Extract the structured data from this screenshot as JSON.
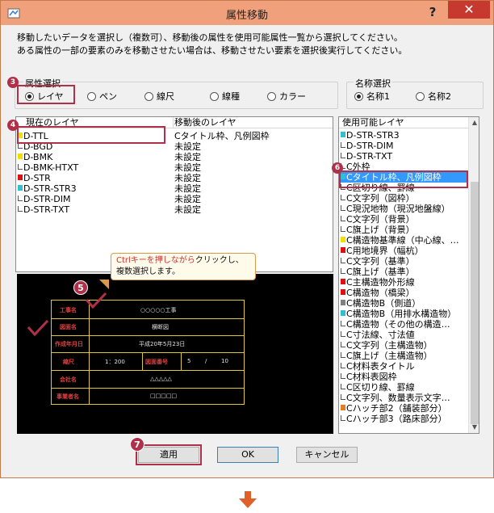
{
  "window": {
    "title": "属性移動",
    "help_label": "?",
    "close_label": "✕"
  },
  "description": [
    "移動したいデータを選択し（複数可）、移動後の属性を使用可能属性一覧から選択してください。",
    "ある属性の一部の要素のみを移動させたい場合は、移動させたい要素を選択後実行してください。"
  ],
  "attribute_group": {
    "legend": "属性選択",
    "options": [
      "レイヤ",
      "ペン",
      "線尺",
      "線種",
      "カラー"
    ],
    "selected": "レイヤ"
  },
  "name_group": {
    "legend": "名称選択",
    "options": [
      "名称1",
      "名称2"
    ],
    "selected": "名称1"
  },
  "layer_list": {
    "headers": [
      "現在のレイヤ",
      "移動後のレイヤ"
    ],
    "rows": [
      {
        "name": "D-TTL",
        "swatch": "#f0e000",
        "target": "Cタイトル枠、凡例図枠"
      },
      {
        "name": "D-BGD",
        "swatch": "outline",
        "target": "未設定"
      },
      {
        "name": "D-BMK",
        "swatch": "#f0e000",
        "target": "未設定"
      },
      {
        "name": "D-BMK-HTXT",
        "swatch": "outline",
        "target": "未設定"
      },
      {
        "name": "D-STR",
        "swatch": "#e01010",
        "target": "未設定"
      },
      {
        "name": "D-STR-STR3",
        "swatch": "#30c0d0",
        "target": "未設定"
      },
      {
        "name": "D-STR-DIM",
        "swatch": "outline",
        "target": "未設定"
      },
      {
        "name": "D-STR-TXT",
        "swatch": "outline",
        "target": "未設定"
      }
    ]
  },
  "available_list": {
    "header": "使用可能レイヤ",
    "items": [
      {
        "name": "D-STR-STR3",
        "swatch": "#30c0d0"
      },
      {
        "name": "D-STR-DIM",
        "swatch": "outline"
      },
      {
        "name": "D-STR-TXT",
        "swatch": "outline"
      },
      {
        "name": "C外枠",
        "swatch": "outline"
      },
      {
        "name": "Cタイトル枠、凡例図枠",
        "swatch": "#30c0d0",
        "selected": true
      },
      {
        "name": "C区切り線、罫線",
        "swatch": "outline"
      },
      {
        "name": "C文字列（図枠）",
        "swatch": "outline"
      },
      {
        "name": "C現況地物（現況地盤線）",
        "swatch": "outline"
      },
      {
        "name": "C文字列（背景）",
        "swatch": "outline"
      },
      {
        "name": "C旗上げ（背景）",
        "swatch": "outline"
      },
      {
        "name": "C構造物基準線（中心線、…",
        "swatch": "#f0e000"
      },
      {
        "name": "C用地境界（幅杭）",
        "swatch": "#e01010"
      },
      {
        "name": "C文字列（基準）",
        "swatch": "outline"
      },
      {
        "name": "C旗上げ（基準）",
        "swatch": "outline"
      },
      {
        "name": "C主構造物外形線",
        "swatch": "#e01010"
      },
      {
        "name": "C構造物（橋梁）",
        "swatch": "#e01010"
      },
      {
        "name": "C構造物B（側道）",
        "swatch": "#808080"
      },
      {
        "name": "C構造物B（用排水構造物）",
        "swatch": "#30c0d0"
      },
      {
        "name": "C構造物（その他の構造…",
        "swatch": "outline"
      },
      {
        "name": "C寸法線、寸法値",
        "swatch": "outline"
      },
      {
        "name": "C文字列（主構造物）",
        "swatch": "outline"
      },
      {
        "name": "C旗上げ（主構造物）",
        "swatch": "outline"
      },
      {
        "name": "C材料表タイトル",
        "swatch": "outline"
      },
      {
        "name": "C材料表図枠",
        "swatch": "outline"
      },
      {
        "name": "C区切り線、罫線",
        "swatch": "outline"
      },
      {
        "name": "C文字列、数量表示文字…",
        "swatch": "outline"
      },
      {
        "name": "Cハッチ部2（舗装部分）",
        "swatch": "#e08020"
      },
      {
        "name": "Cハッチ部3（路床部分）",
        "swatch": "outline"
      }
    ]
  },
  "callout": {
    "highlight": "Ctrlキーを押しながら",
    "rest_line1": "クリックし、",
    "line2": "複数選択します。"
  },
  "preview": {
    "labels": [
      "工事名",
      "図面名",
      "作成年月日",
      "縮尺",
      "会社名",
      "事業者名"
    ],
    "values": {
      "project": "○○○○○工事",
      "drawing": "横断図",
      "date": "平成20年5月23日",
      "scale": "1：200",
      "sheet_label": "図面番号",
      "sheet_num": "5",
      "sheet_sep": "/",
      "sheet_total": "10",
      "company": "△△△△△",
      "operator": "□□□□□"
    }
  },
  "badges": [
    "3",
    "4",
    "5",
    "6",
    "7"
  ],
  "buttons": {
    "apply": "適用",
    "ok": "OK",
    "cancel": "キャンセル"
  },
  "colors": {
    "titlebar": "#f0a07a",
    "close": "#c7382f",
    "highlight": "#b0304a",
    "selection": "#3399ff",
    "callout_text": "#d03030",
    "drawing_border": "#e0c830",
    "arrow": "#e0602a"
  }
}
